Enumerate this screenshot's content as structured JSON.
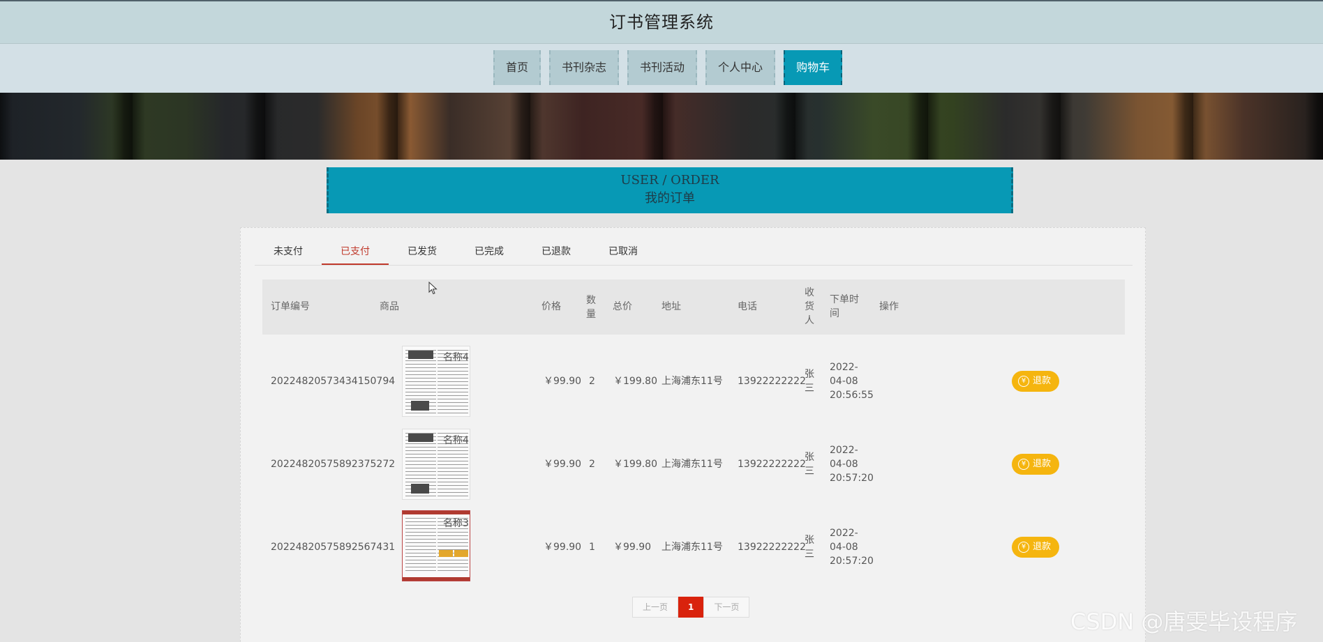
{
  "app": {
    "title": "订书管理系统"
  },
  "nav": {
    "items": [
      {
        "label": "首页"
      },
      {
        "label": "书刊杂志"
      },
      {
        "label": "书刊活动"
      },
      {
        "label": "个人中心"
      },
      {
        "label": "购物车"
      }
    ],
    "active_index": 4
  },
  "heading": {
    "en": "USER / ORDER",
    "cn": "我的订单"
  },
  "tabs": {
    "items": [
      {
        "label": "未支付"
      },
      {
        "label": "已支付"
      },
      {
        "label": "已发货"
      },
      {
        "label": "已完成"
      },
      {
        "label": "已退款"
      },
      {
        "label": "已取消"
      }
    ],
    "active_index": 1
  },
  "table": {
    "headers": {
      "order_no": "订单编号",
      "product": "商品",
      "price": "价格",
      "qty": "数量",
      "total": "总价",
      "address": "地址",
      "phone": "电话",
      "receiver": "收货人",
      "order_time": "下单时间",
      "action": "操作"
    },
    "rows": [
      {
        "order_no": "20224820573434150794",
        "product_name": "名称4",
        "price": "￥99.90",
        "qty": "2",
        "total": "￥199.80",
        "address": "上海浦东11号",
        "phone": "13922222222",
        "receiver": "张三",
        "date": "2022-",
        "date2": "04-08",
        "time": "20:56:55",
        "action": "退款"
      },
      {
        "order_no": "20224820575892375272",
        "product_name": "名称4",
        "price": "￥99.90",
        "qty": "2",
        "total": "￥199.80",
        "address": "上海浦东11号",
        "phone": "13922222222",
        "receiver": "张三",
        "date": "2022-",
        "date2": "04-08",
        "time": "20:57:20",
        "action": "退款"
      },
      {
        "order_no": "20224820575892567431",
        "product_name": "名称3",
        "price": "￥99.90",
        "qty": "1",
        "total": "￥99.90",
        "address": "上海浦东11号",
        "phone": "13922222222",
        "receiver": "张三",
        "date": "2022-",
        "date2": "04-08",
        "time": "20:57:20",
        "action": "退款"
      }
    ]
  },
  "pagination": {
    "prev": "上一页",
    "current": "1",
    "next": "下一页"
  },
  "watermark": "CSDN @唐雯毕设程序",
  "icons": {
    "refund": "yen-icon",
    "cursor": "mouse-pointer-icon"
  },
  "colors": {
    "accent": "#0799b5",
    "refund": "#f5b50f",
    "page_active": "#d9230d",
    "tab_active": "#c0392b"
  }
}
